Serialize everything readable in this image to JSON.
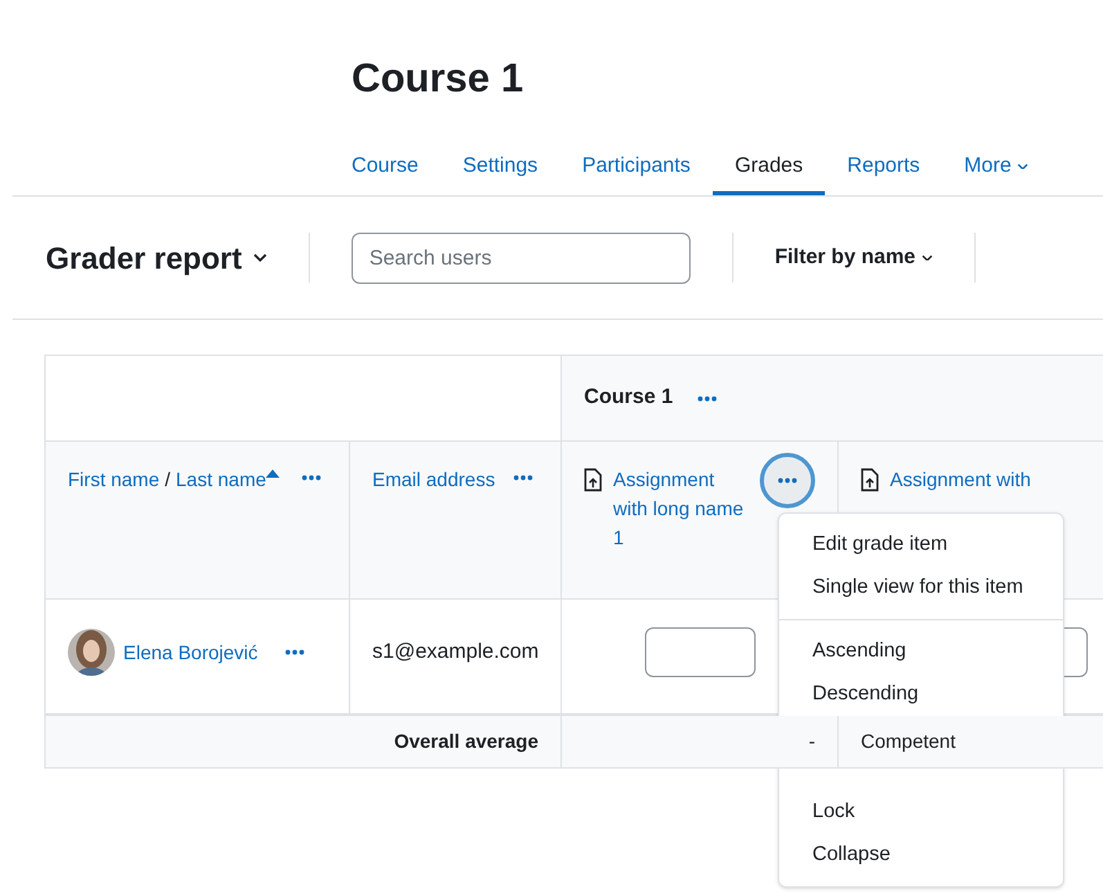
{
  "page_title": "Course 1",
  "tabs": [
    {
      "label": "Course",
      "selected": false
    },
    {
      "label": "Settings",
      "selected": false
    },
    {
      "label": "Participants",
      "selected": false
    },
    {
      "label": "Grades",
      "selected": true
    },
    {
      "label": "Reports",
      "selected": false
    },
    {
      "label": "More",
      "selected": false,
      "kind": "dropdown"
    }
  ],
  "toolbar": {
    "report_title": "Grader report",
    "search": {
      "placeholder": "Search users"
    },
    "filter": "Filter by name"
  },
  "table": {
    "category": "Course 1",
    "columns": [
      {
        "kind": "name",
        "label": "First name",
        "label_2": "Last name",
        "separator": "/",
        "sorted": true
      },
      {
        "kind": "email",
        "label": "Email address"
      },
      {
        "kind": "assignment",
        "label": "Assignment with long name 1",
        "menu_open": true
      },
      {
        "kind": "assignment",
        "label": "Assignment with",
        "menu_open": false
      }
    ],
    "rows": [
      {
        "name": "Elena Borojević",
        "email": "s1@example.com"
      }
    ],
    "average": {
      "label": "Overall average",
      "values": [
        "-",
        "Competent"
      ]
    }
  },
  "menu": {
    "groups": [
      {
        "items": [
          "Edit grade item",
          "Single view for this item"
        ]
      },
      {
        "items": [
          "Ascending",
          "Descending"
        ]
      },
      {
        "items": [
          "Lock",
          "Collapse"
        ]
      }
    ]
  }
}
